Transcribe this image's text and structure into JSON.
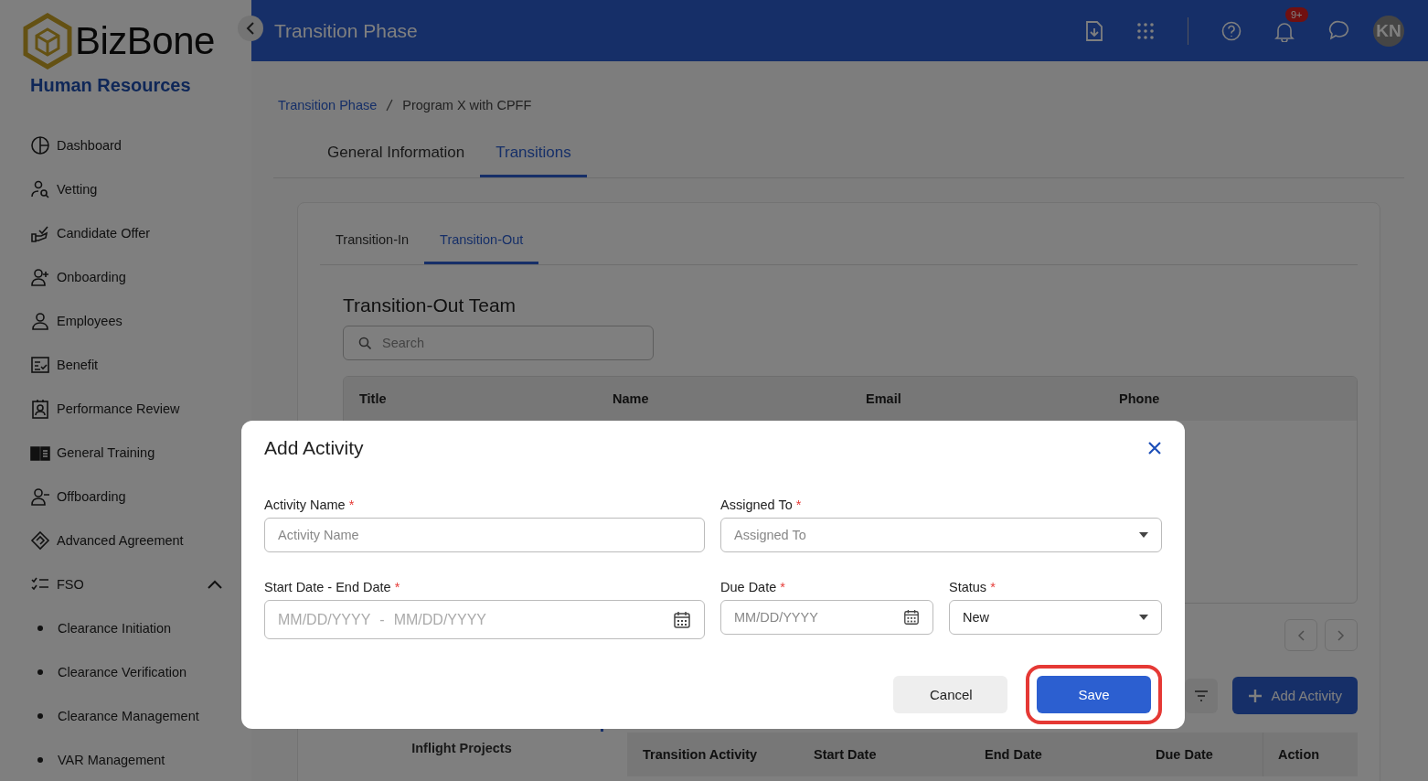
{
  "logo": {
    "name": "BizBone",
    "subtitle": "Human Resources"
  },
  "sidebar": {
    "items": [
      {
        "label": "Dashboard"
      },
      {
        "label": "Vetting"
      },
      {
        "label": "Candidate Offer"
      },
      {
        "label": "Onboarding"
      },
      {
        "label": "Employees"
      },
      {
        "label": "Benefit"
      },
      {
        "label": "Performance Review"
      },
      {
        "label": "General Training"
      },
      {
        "label": "Offboarding"
      },
      {
        "label": "Advanced Agreement"
      },
      {
        "label": "FSO",
        "expanded": true,
        "children": [
          {
            "label": "Clearance Initiation"
          },
          {
            "label": "Clearance Verification"
          },
          {
            "label": "Clearance Management"
          },
          {
            "label": "VAR Management"
          }
        ]
      }
    ]
  },
  "header": {
    "title": "Transition Phase",
    "notification_badge": "9+",
    "avatar": "KN"
  },
  "breadcrumb": [
    "Transition Phase",
    "Program X with CPFF"
  ],
  "tabs": [
    {
      "label": "General Information",
      "selected": false
    },
    {
      "label": "Transitions",
      "selected": true
    }
  ],
  "subtabs": [
    {
      "label": "Transition-In",
      "selected": false
    },
    {
      "label": "Transition-Out",
      "selected": true
    }
  ],
  "team": {
    "title": "Transition-Out Team",
    "search": {
      "placeholder": "Search"
    },
    "columns": [
      "Title",
      "Name",
      "Email",
      "Phone"
    ]
  },
  "activities": {
    "side_tabs": [
      {
        "label": "Inflight Projects"
      }
    ],
    "add_button": "Add Activity",
    "columns": [
      "Transition Activity",
      "Start Date",
      "End Date",
      "Due Date",
      "Action"
    ]
  },
  "modal": {
    "title": "Add Activity",
    "fields": [
      {
        "kind": "text",
        "label": "Activity Name",
        "required_mark": "*",
        "placeholder": "Activity Name"
      },
      {
        "kind": "select",
        "label": "Assigned To",
        "required_mark": "*",
        "placeholder": "Assigned To"
      },
      {
        "kind": "daterange",
        "label": "Start Date - End Date",
        "required_mark": "*",
        "placeholder": "MM/DD/YYYY",
        "placeholder_end": "MM/DD/YYYY",
        "separator": "-"
      },
      {
        "kind": "date",
        "label": "Due Date",
        "required_mark": "*",
        "placeholder": "MM/DD/YYYY"
      },
      {
        "kind": "select",
        "label": "Status",
        "required_mark": "*",
        "value": "New"
      }
    ],
    "buttons": [
      {
        "label": "Cancel",
        "kind": "secondary",
        "highlighted": false
      },
      {
        "label": "Save",
        "kind": "primary",
        "highlighted": true
      }
    ]
  }
}
